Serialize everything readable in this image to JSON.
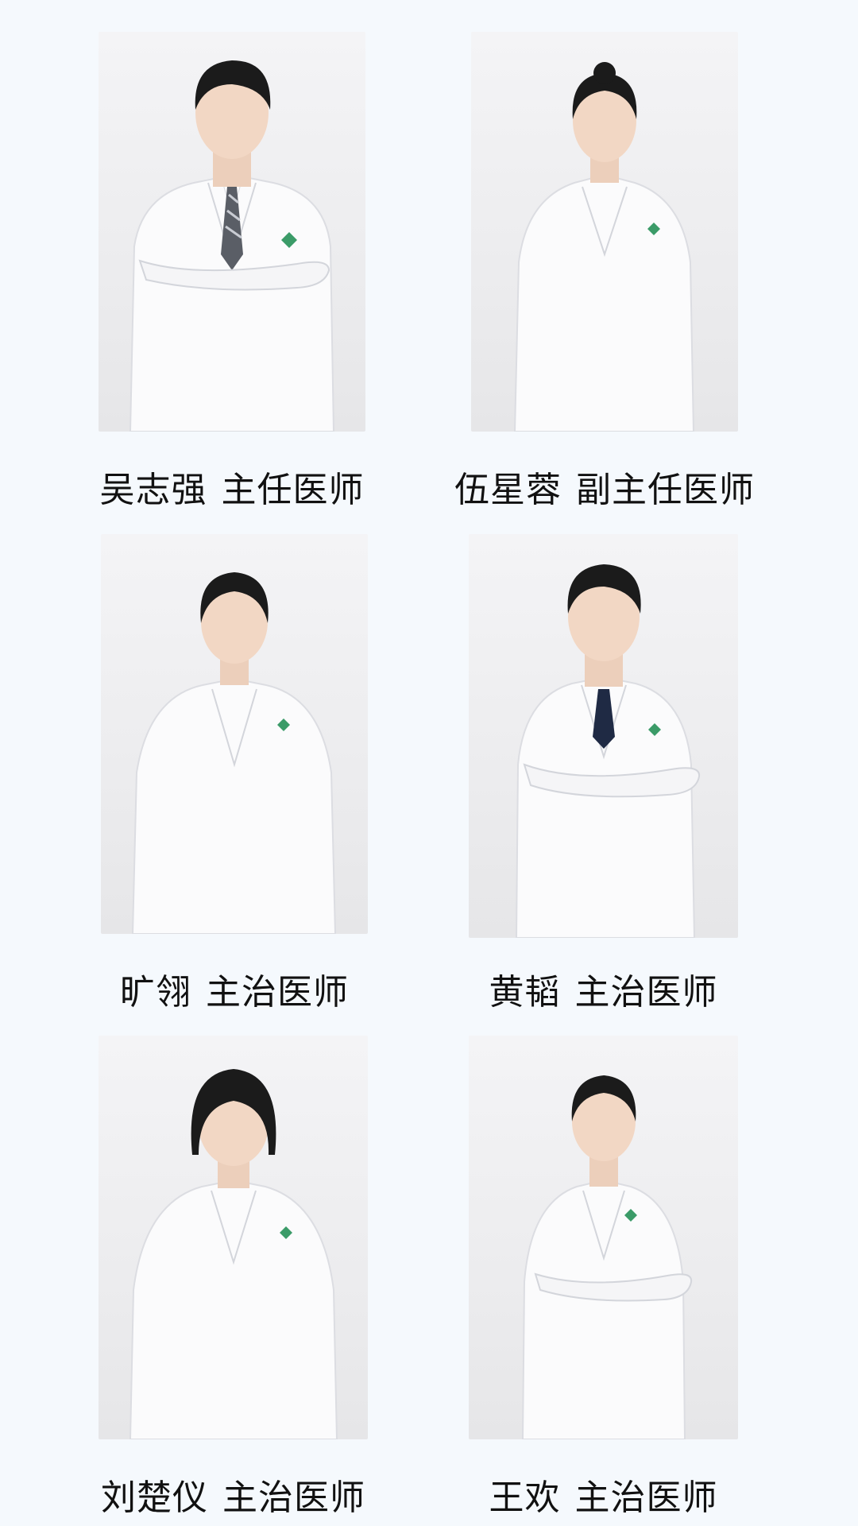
{
  "theme": {
    "background": "#f5f9fd",
    "text_color": "#111111",
    "coat_color": "#ffffff",
    "hair_color": "#1b1b1b",
    "skin_color": "#f2d7c4",
    "logo_color": "#3b9b68"
  },
  "doctors": [
    {
      "name": "吴志强",
      "title": "主任医师",
      "gender": "male",
      "tie": "striped"
    },
    {
      "name": "伍星蓉",
      "title": "副主任医师",
      "gender": "female",
      "tie": "none"
    },
    {
      "name": "旷翎",
      "title": "主治医师",
      "gender": "female",
      "tie": "none"
    },
    {
      "name": "黄韬",
      "title": "主治医师",
      "gender": "male",
      "tie": "navy"
    },
    {
      "name": "刘楚仪",
      "title": "主治医师",
      "gender": "female",
      "tie": "none"
    },
    {
      "name": "王欢",
      "title": "主治医师",
      "gender": "female",
      "tie": "none"
    }
  ]
}
